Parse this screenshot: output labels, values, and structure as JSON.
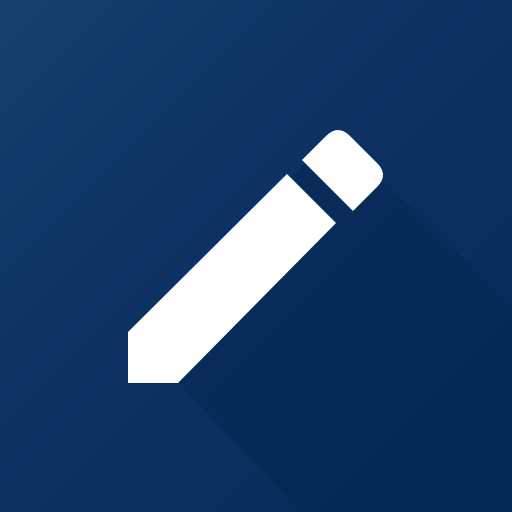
{
  "app_icon": {
    "icon_name": "pencil-icon",
    "colors": {
      "background_start": "#17406f",
      "background_end": "#062a58",
      "glyph": "#ffffff",
      "long_shadow": "#04224a"
    }
  }
}
